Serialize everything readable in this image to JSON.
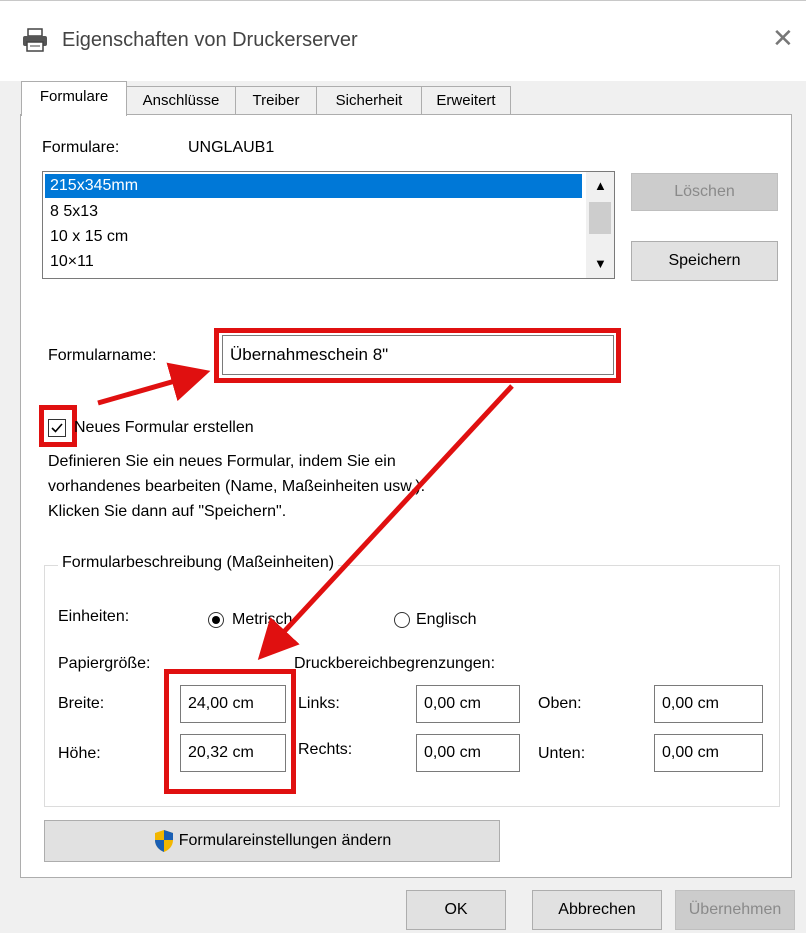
{
  "window": {
    "title": "Eigenschaften von Druckerserver"
  },
  "tabs": [
    "Formulare",
    "Anschlüsse",
    "Treiber",
    "Sicherheit",
    "Erweitert"
  ],
  "formulare": {
    "label": "Formulare:",
    "server": "UNGLAUB1",
    "list": [
      "215x345mm",
      "8 5x13",
      "10 x 15 cm",
      "10×11"
    ],
    "delete_button": "Löschen",
    "save_button": "Speichern"
  },
  "form_name": {
    "label": "Formularname:",
    "value": "Übernahmeschein 8\""
  },
  "new_form": {
    "label": "Neues Formular erstellen",
    "checked": true,
    "desc_line1": "Definieren Sie ein neues Formular, indem Sie ein",
    "desc_line2": "vorhandenes bearbeiten (Name, Maßeinheiten usw.).",
    "desc_line3": "Klicken Sie dann auf \"Speichern\"."
  },
  "description": {
    "group_title": "Formularbeschreibung (Maßeinheiten)",
    "units_label": "Einheiten:",
    "metric_label": "Metrisch",
    "english_label": "Englisch",
    "paper_size_label": "Papiergröße:",
    "print_area_label": "Druckbereichbegrenzungen:",
    "width_label": "Breite:",
    "width_value": "24,00 cm",
    "height_label": "Höhe:",
    "height_value": "20,32 cm",
    "left_label": "Links:",
    "left_value": "0,00 cm",
    "right_label": "Rechts:",
    "right_value": "0,00 cm",
    "top_label": "Oben:",
    "top_value": "0,00 cm",
    "bottom_label": "Unten:",
    "bottom_value": "0,00 cm"
  },
  "change_settings_button": "Formulareinstellungen ändern",
  "footer": {
    "ok": "OK",
    "cancel": "Abbrechen",
    "apply": "Übernehmen"
  },
  "colors": {
    "annotation": "#e01010",
    "selection": "#0078d7"
  }
}
